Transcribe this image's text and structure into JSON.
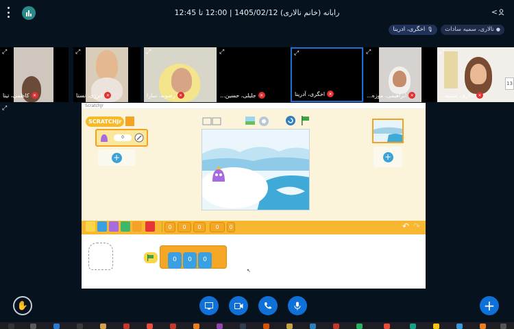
{
  "header": {
    "title": "رابانه (خانم نالاری) 1405/02/12 | 12:00 تا 12:45",
    "user_toggle": "<"
  },
  "presenters": [
    {
      "label": "نالاری، سمیه سادات",
      "icon": "person-icon"
    },
    {
      "label": "اخگری، ادرینا",
      "icon": "mic-icon"
    }
  ],
  "videos": [
    {
      "name": "کاظمی، تینا"
    },
    {
      "name": "انرژی، نستا"
    },
    {
      "name": "رضویه، سارا"
    },
    {
      "name": "جلیلی، حسین..."
    },
    {
      "name": "اخگری، آدرینا"
    },
    {
      "name": "ابراهیمی، موزه..."
    },
    {
      "name": "نالاری، سمیه..."
    }
  ],
  "extra_label": "13",
  "scratch": {
    "header_text": "ScratchJr",
    "logo_text": "SCRATCHJr",
    "sprite_value": "0",
    "palette_symbols": [
      "0",
      "0",
      "0",
      "0",
      "0"
    ],
    "script_labels": [
      "0",
      "0",
      "0"
    ]
  },
  "colors": {
    "accent": "#0f70d7",
    "mute": "#e03131",
    "palette": "#f8b731"
  }
}
